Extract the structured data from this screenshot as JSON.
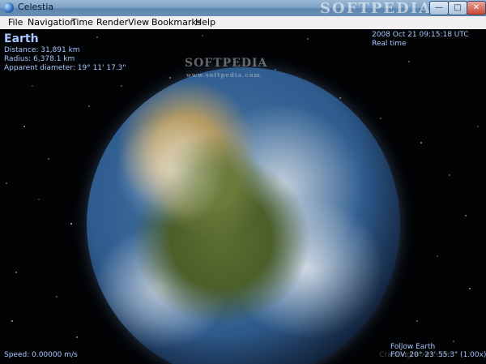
{
  "window": {
    "title": "Celestia",
    "watermark": "SOFTPEDIA",
    "controls": {
      "minimize": "—",
      "maximize": "□",
      "close": "✕"
    }
  },
  "menu": {
    "items": [
      "File",
      "Navigation",
      "Time",
      "Render",
      "View",
      "Bookmarks",
      "Help"
    ]
  },
  "hud": {
    "object_name": "Earth",
    "distance": "Distance: 31,891 km",
    "radius": "Radius: 6,378.1 km",
    "apparent_diameter": "Apparent diameter: 19° 11' 17.3\"",
    "datetime": "2008 Oct 21 09:15:18 UTC",
    "time_mode": "Real time",
    "speed": "Speed: 0.00000 m/s",
    "follow": "Follow Earth",
    "fov": "FOV: 20° 23' 55.3\" (1.00x)",
    "center_watermark": "SOFTPEDIA",
    "center_watermark_small": "www.softpedia.com",
    "footer_watermark": "Crackingfwows.com"
  },
  "icons": {
    "app": "celestia-globe-icon",
    "minimize": "minimize-icon",
    "maximize": "maximize-icon",
    "close": "close-icon"
  }
}
